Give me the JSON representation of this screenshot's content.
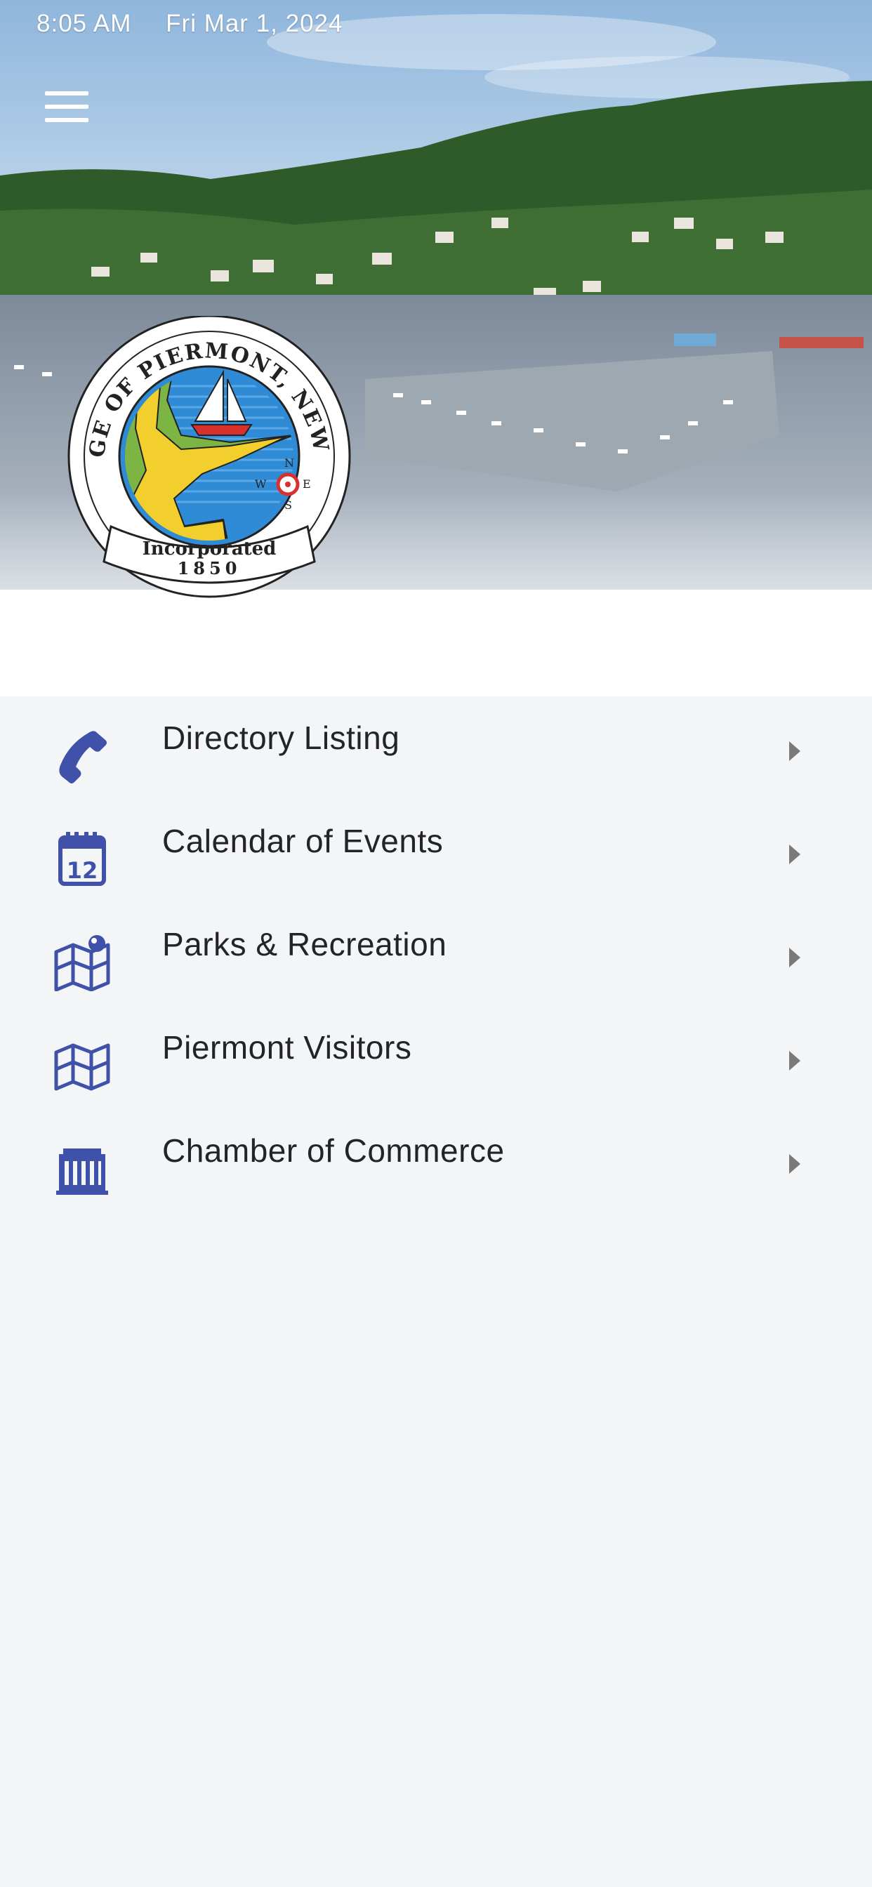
{
  "status_bar": {
    "time": "8:05 AM",
    "date": "Fri Mar 1, 2024"
  },
  "seal": {
    "ring_text": "VILLAGE OF PIERMONT, NEW YORK",
    "ribbon_line1": "Incorporated",
    "ribbon_line2": "1850",
    "compass": [
      "N",
      "W",
      "E",
      "S"
    ]
  },
  "menu_items": [
    {
      "label": "Directory Listing",
      "icon": "phone-icon"
    },
    {
      "label": "Calendar of Events",
      "icon": "calendar-icon"
    },
    {
      "label": "Parks & Recreation",
      "icon": "map-pin-icon"
    },
    {
      "label": "Piermont Visitors",
      "icon": "map-icon"
    },
    {
      "label": "Chamber of Commerce",
      "icon": "building-icon"
    }
  ],
  "colors": {
    "accent": "#3f51a8",
    "background": "#f4f5f7",
    "text": "#222428"
  }
}
